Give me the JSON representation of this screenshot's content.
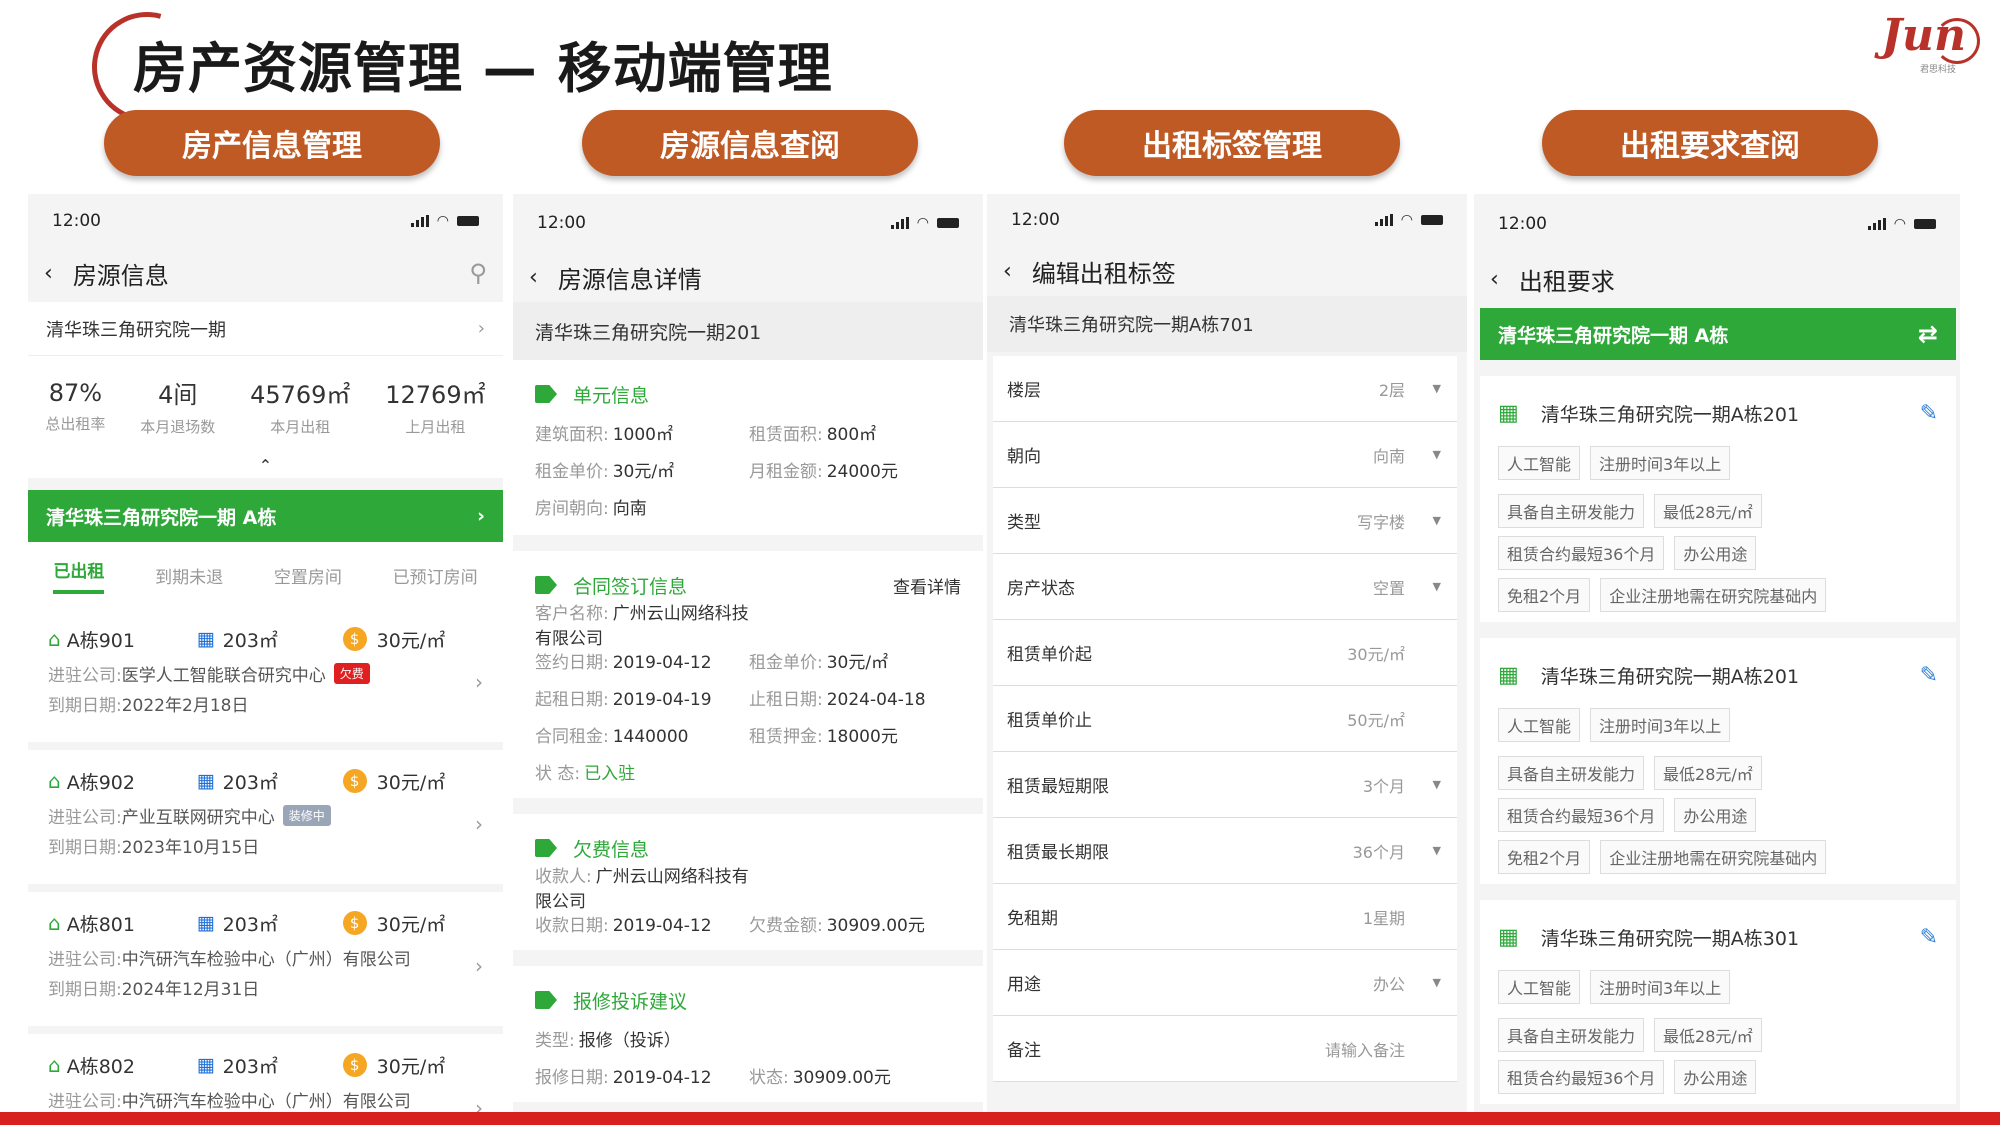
{
  "title": "房产资源管理 — 移动端管理",
  "logo": {
    "text": "Jun",
    "sub": "君思科技"
  },
  "pills": [
    "房产信息管理",
    "房源信息查阅",
    "出租标签管理",
    "出租要求查阅"
  ],
  "status_time": "12:00",
  "p1": {
    "nav_title": "房源信息",
    "project": "清华珠三角研究院一期",
    "stats": [
      {
        "value": "87%",
        "label": "总出租率"
      },
      {
        "value": "4间",
        "label": "本月退场数"
      },
      {
        "value": "45769㎡",
        "label": "本月出租"
      },
      {
        "value": "12769㎡",
        "label": "上月出租"
      }
    ],
    "building": "清华珠三角研究院一期 A栋",
    "tabs": [
      "已出租",
      "到期未退",
      "空置房间",
      "已预订房间"
    ],
    "units": [
      {
        "unit": "A栋901",
        "area": "203㎡",
        "price": "30元/㎡",
        "company_label": "进驻公司:",
        "company": "医学人工智能联合研究中心",
        "badge": "欠费",
        "date_label": "到期日期:",
        "date": "2022年2月18日"
      },
      {
        "unit": "A栋902",
        "area": "203㎡",
        "price": "30元/㎡",
        "company_label": "进驻公司:",
        "company": "产业互联网研究中心",
        "badge": "装修中",
        "date_label": "到期日期:",
        "date": "2023年10月15日"
      },
      {
        "unit": "A栋801",
        "area": "203㎡",
        "price": "30元/㎡",
        "company_label": "进驻公司:",
        "company": "中汽研汽车检验中心（广州）有限公司",
        "badge": "",
        "date_label": "到期日期:",
        "date": "2024年12月31日"
      },
      {
        "unit": "A栋802",
        "area": "203㎡",
        "price": "30元/㎡",
        "company_label": "进驻公司:",
        "company": "中汽研汽车检验中心（广州）有限公司",
        "badge": "",
        "date_label": "",
        "date": ""
      }
    ]
  },
  "p2": {
    "nav_title": "房源信息详情",
    "room": "清华珠三角研究院一期201",
    "unit_title": "单元信息",
    "unit_fields": [
      [
        "建筑面积:",
        "1000㎡",
        "租赁面积:",
        "800㎡"
      ],
      [
        "租金单价:",
        "30元/㎡",
        "月租金额:",
        "24000元"
      ],
      [
        "房间朝向:",
        "向南",
        "",
        ""
      ]
    ],
    "contract_title": "合同签订信息",
    "contract_link": "查看详情",
    "contract_fields": [
      [
        "客户名称:",
        "广州云山网络科技有限公司",
        "",
        ""
      ],
      [
        "签约日期:",
        "2019-04-12",
        "租金单价:",
        "30元/㎡"
      ],
      [
        "起租日期:",
        "2019-04-19",
        "止租日期:",
        "2024-04-18"
      ],
      [
        "合同租金:",
        "1440000",
        "租赁押金:",
        "18000元"
      ],
      [
        "状      态:",
        "已入驻",
        "",
        ""
      ]
    ],
    "arrears_title": "欠费信息",
    "arrears_fields": [
      [
        "收款人:",
        "广州云山网络科技有限公司",
        "",
        ""
      ],
      [
        "收款日期:",
        "2019-04-12",
        "欠费金额:",
        "30909.00元"
      ]
    ],
    "repair_title": "报修投诉建议",
    "repair_fields": [
      [
        "类型:",
        "报修（投诉）",
        "",
        ""
      ],
      [
        "报修日期:",
        "2019-04-12",
        "状态:",
        "30909.00元"
      ]
    ]
  },
  "p3": {
    "nav_title": "编辑出租标签",
    "room": "清华珠三角研究院一期A栋701",
    "fields": [
      {
        "label": "楼层",
        "value": "2层",
        "dropdown": true
      },
      {
        "label": "朝向",
        "value": "向南",
        "dropdown": true
      },
      {
        "label": "类型",
        "value": "写字楼",
        "dropdown": true
      },
      {
        "label": "房产状态",
        "value": "空置",
        "dropdown": true
      },
      {
        "label": "租赁单价起",
        "value": "30元/㎡",
        "dropdown": false
      },
      {
        "label": "租赁单价止",
        "value": "50元/㎡",
        "dropdown": false
      },
      {
        "label": "租赁最短期限",
        "value": "3个月",
        "dropdown": true
      },
      {
        "label": "租赁最长期限",
        "value": "36个月",
        "dropdown": true
      },
      {
        "label": "免租期",
        "value": "1星期",
        "dropdown": false
      },
      {
        "label": "用途",
        "value": "办公",
        "dropdown": true
      },
      {
        "label": "备注",
        "value": "请输入备注",
        "dropdown": false
      }
    ]
  },
  "p4": {
    "nav_title": "出租要求",
    "building": "清华珠三角研究院一期 A栋",
    "cards": [
      {
        "room": "清华珠三角研究院一期A栋201",
        "chips": [
          [
            "人工智能",
            "注册时间3年以上"
          ],
          [
            "具备自主研发能力",
            "最低28元/㎡"
          ],
          [
            "租赁合约最短36个月",
            "办公用途"
          ],
          [
            "免租2个月",
            "企业注册地需在研究院基础内"
          ]
        ]
      },
      {
        "room": "清华珠三角研究院一期A栋201",
        "chips": [
          [
            "人工智能",
            "注册时间3年以上"
          ],
          [
            "具备自主研发能力",
            "最低28元/㎡"
          ],
          [
            "租赁合约最短36个月",
            "办公用途"
          ],
          [
            "免租2个月",
            "企业注册地需在研究院基础内"
          ]
        ]
      },
      {
        "room": "清华珠三角研究院一期A栋301",
        "chips": [
          [
            "人工智能",
            "注册时间3年以上"
          ],
          [
            "具备自主研发能力",
            "最低28元/㎡"
          ],
          [
            "租赁合约最短36个月",
            "办公用途"
          ]
        ]
      }
    ]
  },
  "colors": {
    "pill": "#bf5a24",
    "green": "#2fa83a",
    "accent_red": "#d6211e"
  }
}
